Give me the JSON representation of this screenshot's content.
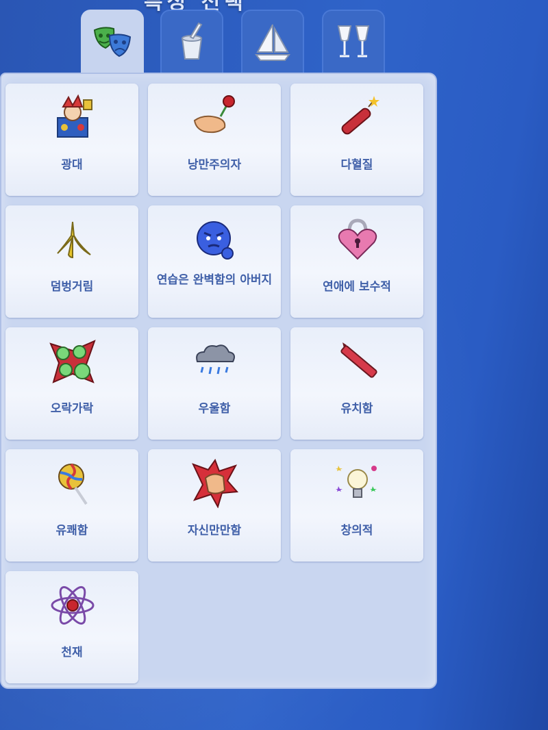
{
  "header": {
    "title": "특성 선택"
  },
  "tabs": [
    {
      "name": "emotional-traits",
      "icon": "theater-masks-icon",
      "active": true
    },
    {
      "name": "hobby-traits",
      "icon": "paint-bucket-icon",
      "active": false
    },
    {
      "name": "lifestyle-traits",
      "icon": "sailboat-icon",
      "active": false
    },
    {
      "name": "social-traits",
      "icon": "champagne-glasses-icon",
      "active": false
    }
  ],
  "traits": [
    {
      "label": "광대",
      "icon": "jester-box-icon"
    },
    {
      "label": "낭만주의자",
      "icon": "hand-rose-icon"
    },
    {
      "label": "다혈질",
      "icon": "dynamite-icon"
    },
    {
      "label": "덤벙거림",
      "icon": "banana-peel-icon"
    },
    {
      "label": "연습은 완벽함의 아버지",
      "icon": "angry-face-icon"
    },
    {
      "label": "연애에 보수적",
      "icon": "heart-lock-icon"
    },
    {
      "label": "오락가락",
      "icon": "mood-faces-icon"
    },
    {
      "label": "우울함",
      "icon": "rain-cloud-icon"
    },
    {
      "label": "유치함",
      "icon": "crayon-icon"
    },
    {
      "label": "유쾌함",
      "icon": "lollipop-icon"
    },
    {
      "label": "자신만만함",
      "icon": "fist-icon"
    },
    {
      "label": "창의적",
      "icon": "lightbulb-icon"
    },
    {
      "label": "천재",
      "icon": "atom-icon"
    }
  ]
}
